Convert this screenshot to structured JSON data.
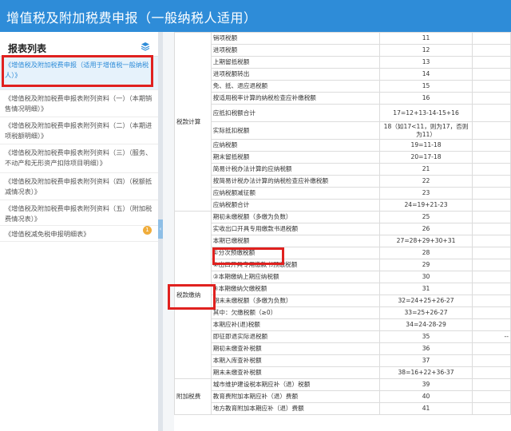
{
  "header": {
    "title": "增值税及附加税费申报（一般纳税人适用）"
  },
  "sidebar": {
    "title": "报表列表",
    "items": [
      {
        "label": "《增值税及附加税费申报（适用于增值税一般纳税人）》"
      },
      {
        "label": "《增值税及附加税费申报表附列资料（一）（本期销售情况明细）》"
      },
      {
        "label": "《增值税及附加税费申报表附列资料（二）（本期进项税额明细）》"
      },
      {
        "label": "《增值税及附加税费申报表附列资料（三）（服务、不动产和无形资产扣除项目明细）》"
      },
      {
        "label": "《增值税及附加税费申报表附列资料（四）（税额抵减情况表）》"
      },
      {
        "label": "《增值税及附加税费申报表附列资料（五）（附加税费情况表）》"
      },
      {
        "label": "《增值税减免税申报明细表》"
      }
    ],
    "badge": "1"
  },
  "table": {
    "categories": {
      "tax_calc": "税款计算",
      "tax_pay": "税款缴纳",
      "surcharge": "附加税费"
    },
    "rows": [
      {
        "name": "销项税额",
        "num": "11"
      },
      {
        "name": "进项税额",
        "num": "12"
      },
      {
        "name": "上期留抵税额",
        "num": "13"
      },
      {
        "name": "进项税额转出",
        "num": "14"
      },
      {
        "name": "免、抵、退应退税额",
        "num": "15"
      },
      {
        "name": "按适用税率计算的纳税检查应补缴税额",
        "num": "16"
      },
      {
        "name": "应抵扣税额合计",
        "num": "17=12+13-14-15+16"
      },
      {
        "name": "实际抵扣税额",
        "num": "18（如17<11，则为17，否则为11）"
      },
      {
        "name": "应纳税额",
        "num": "19=11-18"
      },
      {
        "name": "期末留抵税额",
        "num": "20=17-18"
      },
      {
        "name": "简易计税办法计算的应纳税额",
        "num": "21"
      },
      {
        "name": "按简易计税办法计算的纳税检查应补缴税额",
        "num": "22"
      },
      {
        "name": "应纳税额减征额",
        "num": "23"
      },
      {
        "name": "应纳税额合计",
        "num": "24=19+21-23"
      },
      {
        "name": "期初未缴税额（多缴为负数）",
        "num": "25"
      },
      {
        "name": "实收出口开具专用缴款书退税额",
        "num": "26"
      },
      {
        "name": "本期已缴税额",
        "num": "27=28+29+30+31"
      },
      {
        "name": "①分次预缴税额",
        "num": "28"
      },
      {
        "name": "②出口开具专用缴款书预缴税额",
        "num": "29"
      },
      {
        "name": "③本期缴纳上期应纳税额",
        "num": "30"
      },
      {
        "name": "④本期缴纳欠缴税额",
        "num": "31"
      },
      {
        "name": "期末未缴税额（多缴为负数）",
        "num": "32=24+25+26-27"
      },
      {
        "name": "其中：欠缴税额（≥0）",
        "num": "33=25+26-27"
      },
      {
        "name": "本期应补(退)税额",
        "num": "34=24-28-29"
      },
      {
        "name": "即征即退实际退税额",
        "num": "35",
        "extra": "--"
      },
      {
        "name": "期初未缴查补税额",
        "num": "36"
      },
      {
        "name": "本期入库查补税额",
        "num": "37"
      },
      {
        "name": "期末未缴查补税额",
        "num": "38=16+22+36-37"
      },
      {
        "name": "城市维护建设税本期应补（退）税额",
        "num": "39"
      },
      {
        "name": "教育费附加本期应补（退）费额",
        "num": "40"
      },
      {
        "name": "地方教育附加本期应补（退）费额",
        "num": "41"
      }
    ]
  }
}
